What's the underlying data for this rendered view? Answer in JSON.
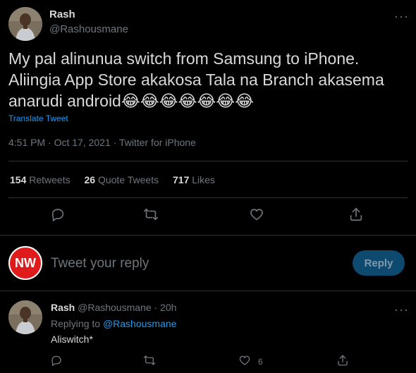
{
  "tweet": {
    "author_name": "Rash",
    "author_handle": "@Rashousmane",
    "text": "My pal alinunua switch from Samsung to iPhone. Aliingia App Store akakosa Tala na Branch akasema anarudi android😂😂😂😂😂😂😂",
    "translate_label": "Translate Tweet",
    "timestamp": "4:51 PM · Oct 17, 2021 · Twitter for iPhone",
    "stats": {
      "retweets_count": "154",
      "retweets_label": "Retweets",
      "quotes_count": "26",
      "quotes_label": "Quote Tweets",
      "likes_count": "717",
      "likes_label": "Likes"
    }
  },
  "composer": {
    "avatar_text": "NW",
    "placeholder": "Tweet your reply",
    "reply_button": "Reply"
  },
  "reply": {
    "author_name": "Rash",
    "author_handle": "@Rashousmane · 20h",
    "replying_prefix": "Replying to",
    "replying_to": "@Rashousmane",
    "text": "Aliswitch*",
    "like_count": "6"
  },
  "colors": {
    "background": "#000000",
    "accent": "#1d9bf0",
    "muted": "#6e767d",
    "text": "#d9d9d9",
    "reply_button_bg": "#0e4a6f",
    "nw_badge": "#e01b1b"
  },
  "icons": [
    "more-icon",
    "comment-icon",
    "retweet-icon",
    "like-icon",
    "share-icon"
  ]
}
